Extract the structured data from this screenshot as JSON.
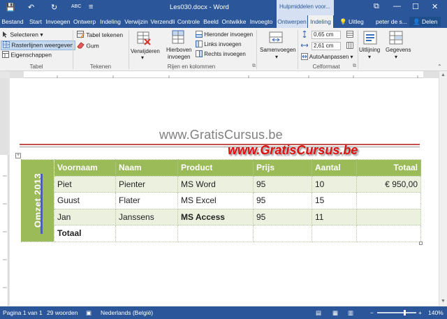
{
  "titlebar": {
    "title": "Les030.docx - Word",
    "context_label": "Hulpmiddelen voor...",
    "qa_save": "💾",
    "qa_undo": "↶",
    "qa_redo": "↻",
    "qa_spell": "ABC",
    "qa_more": "≡",
    "win_restore": "⧉",
    "win_min": "—",
    "win_max": "☐",
    "win_close": "✕"
  },
  "tabs": {
    "file": "Bestand",
    "start": "Start",
    "invoegen": "Invoegen",
    "ontwerp": "Ontwerp",
    "indeling1": "Indeling",
    "verwijzingen": "Verwijzin",
    "verzendlijsten": "Verzendli",
    "controleren": "Controle",
    "beeld": "Beeld",
    "ontwikkelaars": "Ontwikke",
    "invoegtoepassingen": "Invoegto",
    "ontwerpen": "Ontwerpen",
    "indeling2": "Indeling",
    "help": "Uitleg",
    "user": "peter de s...",
    "share": "Delen"
  },
  "ribbon": {
    "tabel": {
      "selecteren": "Selecteren ▾",
      "rasterlijnen": "Rasterlijnen weergeven",
      "eigenschappen": "Eigenschappen",
      "label": "Tabel"
    },
    "tekenen": {
      "tabel_tekenen": "Tabel tekenen",
      "gum": "Gum",
      "label": "Tekenen"
    },
    "rijen": {
      "verwijderen": "Verwijderen",
      "hierboven": "Hierboven",
      "invoegen": "invoegen",
      "hieronder": "Hieronder invoegen",
      "links": "Links invoegen",
      "rechts": "Rechts invoegen",
      "label": "Rijen en kolommen"
    },
    "samenvoegen": {
      "label_btn": "Samenvoegen",
      "dropdown": "▾"
    },
    "celformaat": {
      "height": "0,65 cm",
      "width": "2,61 cm",
      "autoaanpassen": "AutoAanpassen ▾",
      "label": "Celformaat"
    },
    "uitlijning": "Uitlijning",
    "gegevens": "Gegevens"
  },
  "document": {
    "watermark_grey": "www.GratisCursus.be",
    "watermark_red": "www.GratisCursus.be",
    "side_label": "Omzet 2013",
    "headers": [
      "Voornaam",
      "Naam",
      "Product",
      "Prijs",
      "Aantal",
      "Totaal"
    ],
    "rows": [
      [
        "Piet",
        "Pienter",
        "MS Word",
        "95",
        "10",
        "€  950,00"
      ],
      [
        "Guust",
        "Flater",
        "MS Excel",
        "95",
        "15",
        ""
      ],
      [
        "Jan",
        "Janssens",
        "MS Access",
        "95",
        "11",
        ""
      ],
      [
        "Totaal",
        "",
        "",
        "",
        "",
        ""
      ]
    ],
    "table_move_handle": "+"
  },
  "status": {
    "page": "Pagina 1 van 1",
    "words": "29 woorden",
    "language": "Nederlands (België)",
    "zoom_minus": "−",
    "zoom_plus": "+",
    "zoom": "140%"
  },
  "colors": {
    "word_blue": "#2b579a",
    "table_green": "#9bbb59",
    "table_band": "#ebf1de",
    "watermark_red": "#e01010"
  }
}
